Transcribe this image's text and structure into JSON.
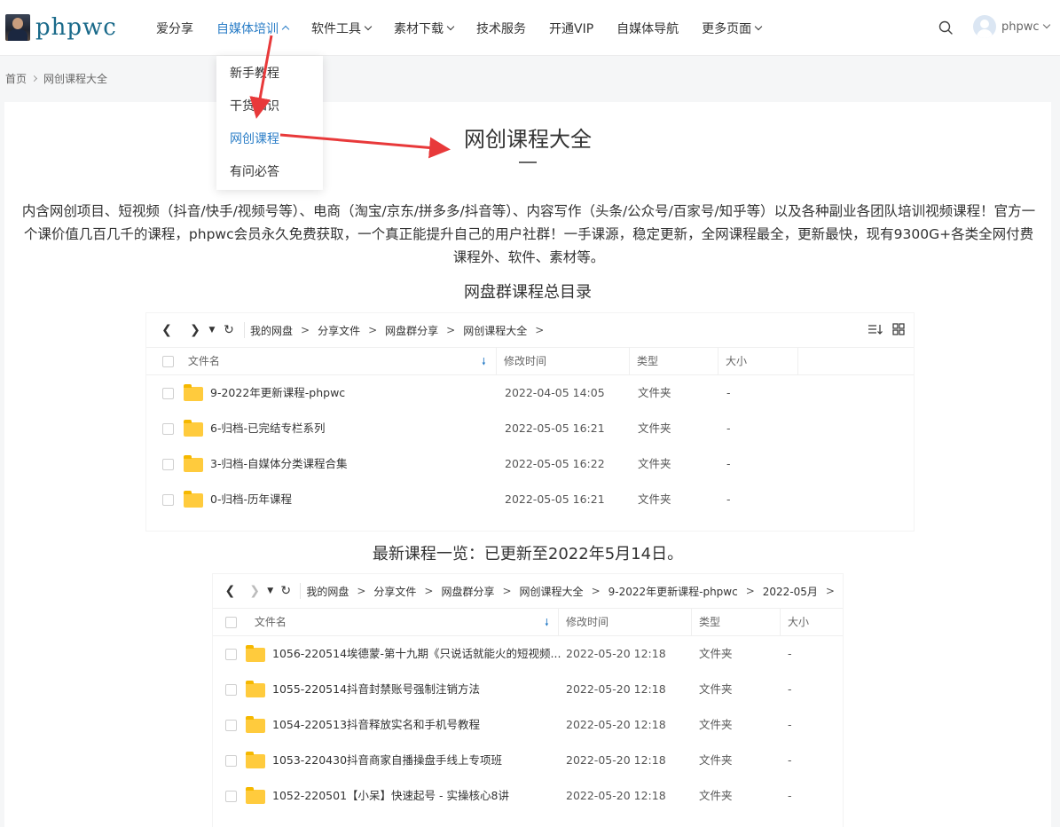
{
  "header": {
    "logo_text": "phpwc",
    "nav": [
      {
        "label": "爱分享",
        "has_dropdown": false
      },
      {
        "label": "自媒体培训",
        "has_dropdown": true,
        "active": true
      },
      {
        "label": "软件工具",
        "has_dropdown": true
      },
      {
        "label": "素材下载",
        "has_dropdown": true
      },
      {
        "label": "技术服务",
        "has_dropdown": false
      },
      {
        "label": "开通VIP",
        "has_dropdown": false
      },
      {
        "label": "自媒体导航",
        "has_dropdown": false
      },
      {
        "label": "更多页面",
        "has_dropdown": true
      }
    ],
    "username": "phpwc"
  },
  "dropdown": {
    "items": [
      "新手教程",
      "干货知识",
      "网创课程",
      "有问必答"
    ],
    "active_index": 2
  },
  "breadcrumb": {
    "home": "首页",
    "current": "网创课程大全"
  },
  "main": {
    "title": "网创课程大全",
    "intro": "内含网创项目、短视频（抖音/快手/视频号等）、电商（淘宝/京东/拼多多/抖音等）、内容写作（头条/公众号/百家号/知乎等）以及各种副业各团队培训视频课程！官方一个课价值几百几千的课程，phpwc会员永久免费获取，一个真正能提升自己的用户社群！一手课源，稳定更新，全网课程最全，更新最快，现有9300G+各类全网付费课程外、软件、素材等。",
    "section1_title": "网盘群课程总目录",
    "section2_title": "最新课程一览：已更新至2022年5月14日。"
  },
  "panel1": {
    "breadcrumb": [
      "我的网盘",
      "分享文件",
      "网盘群分享",
      "网创课程大全"
    ],
    "columns": {
      "name": "文件名",
      "modified": "修改时间",
      "type": "类型",
      "size": "大小"
    },
    "rows": [
      {
        "name": "9-2022年更新课程-phpwc",
        "modified": "2022-04-05 14:05",
        "type": "文件夹",
        "size": "-"
      },
      {
        "name": "6-归档-已完结专栏系列",
        "modified": "2022-05-05 16:21",
        "type": "文件夹",
        "size": "-"
      },
      {
        "name": "3-归档-自媒体分类课程合集",
        "modified": "2022-05-05 16:22",
        "type": "文件夹",
        "size": "-"
      },
      {
        "name": "0-归档-历年课程",
        "modified": "2022-05-05 16:21",
        "type": "文件夹",
        "size": "-"
      }
    ]
  },
  "panel2": {
    "breadcrumb": [
      "我的网盘",
      "分享文件",
      "网盘群分享",
      "网创课程大全",
      "9-2022年更新课程-phpwc",
      "2022-05月"
    ],
    "columns": {
      "name": "文件名",
      "modified": "修改时间",
      "type": "类型",
      "size": "大小"
    },
    "rows": [
      {
        "name": "1056-220514埃德蒙-第十九期《只说话就能火的短视频...",
        "modified": "2022-05-20 12:18",
        "type": "文件夹",
        "size": "-"
      },
      {
        "name": "1055-220514抖音封禁账号强制注销方法",
        "modified": "2022-05-20 12:18",
        "type": "文件夹",
        "size": "-"
      },
      {
        "name": "1054-220513抖音释放实名和手机号教程",
        "modified": "2022-05-20 12:18",
        "type": "文件夹",
        "size": "-"
      },
      {
        "name": "1053-220430抖音商家自播操盘手线上专项班",
        "modified": "2022-05-20 12:18",
        "type": "文件夹",
        "size": "-"
      },
      {
        "name": "1052-220501【小呆】快速起号 - 实操核心8讲",
        "modified": "2022-05-20 12:18",
        "type": "文件夹",
        "size": "-"
      }
    ]
  },
  "colors": {
    "accent": "#2b7ec7",
    "annotation_arrow": "#e8393a",
    "folder": "#ffcb3d"
  }
}
